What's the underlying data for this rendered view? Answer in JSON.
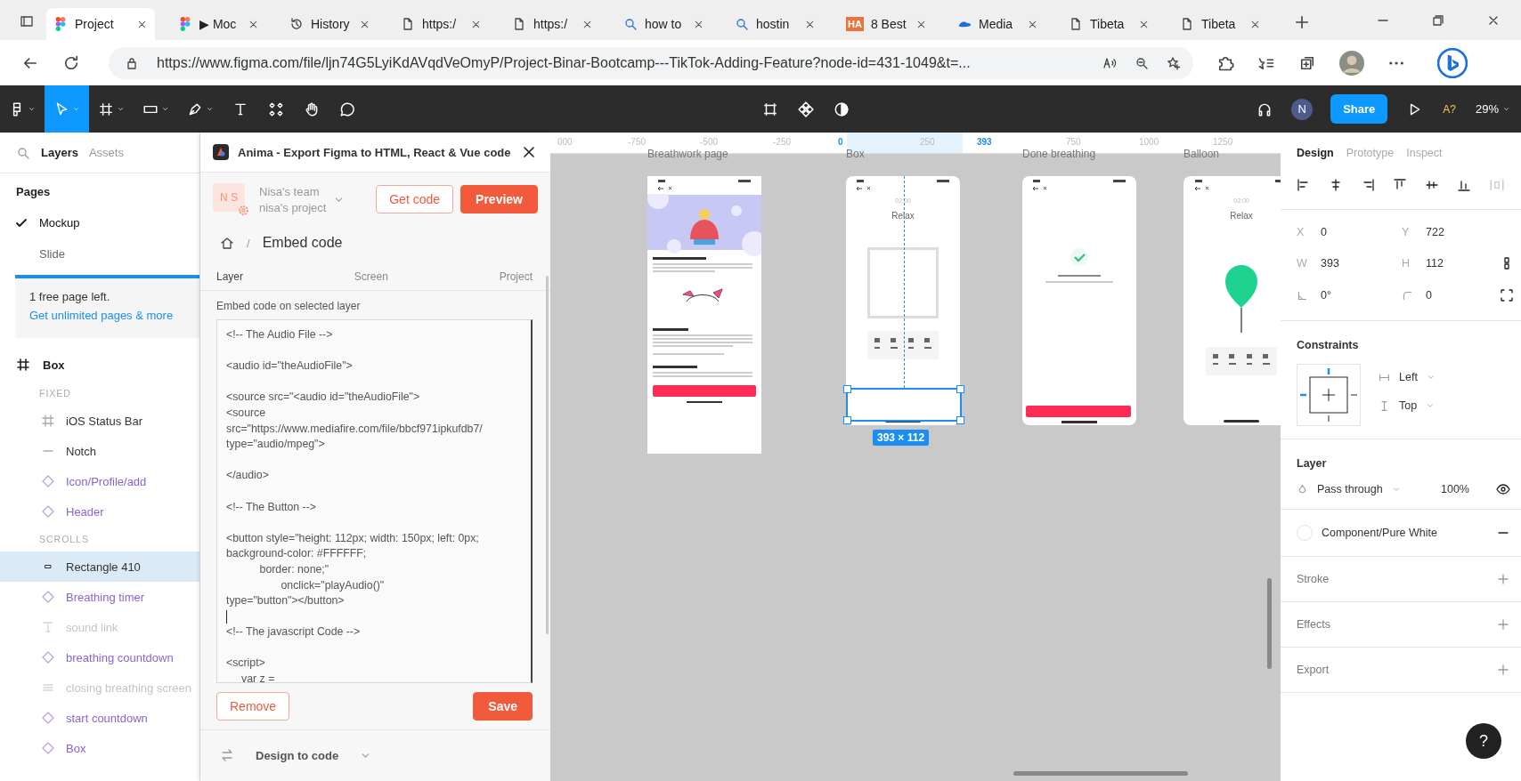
{
  "browser": {
    "tabs": [
      {
        "title": "Project",
        "selected": true
      },
      {
        "title": "▶ Moc",
        "selected": false
      },
      {
        "title": "History",
        "selected": false
      },
      {
        "title": "https:/",
        "selected": false
      },
      {
        "title": "https:/",
        "selected": false
      },
      {
        "title": "how to",
        "selected": false
      },
      {
        "title": "hostin",
        "selected": false
      },
      {
        "badge": "HA",
        "title": "8 Best",
        "selected": false
      },
      {
        "title": "Media",
        "selected": false
      },
      {
        "title": "Tibeta",
        "selected": false
      },
      {
        "title": "Tibeta",
        "selected": false
      }
    ],
    "url": "https://www.figma.com/file/ljn74G5LyiKdAVqdVeOmyP/Project-Binar-Bootcamp---TikTok-Adding-Feature?node-id=431-1049&t=..."
  },
  "toolbar": {
    "user_initial": "N",
    "share": "Share",
    "font_warning": "A?",
    "zoom": "29%"
  },
  "layers_panel": {
    "tabs": [
      {
        "label": "Layers",
        "selected": true
      },
      {
        "label": "Assets",
        "selected": false
      }
    ],
    "pages_title": "Pages",
    "pages": [
      {
        "label": "Mockup",
        "selected": true
      },
      {
        "label": "Slide",
        "selected": false
      }
    ],
    "promo": {
      "text": "1 free page left.",
      "link": "Get unlimited pages & more"
    },
    "frame": "Box",
    "groups": [
      {
        "title": "FIXED",
        "layers": [
          {
            "kind": "frame",
            "label": "iOS Status Bar",
            "selected": false,
            "hidden": false
          },
          {
            "kind": "line",
            "label": "Notch",
            "selected": false,
            "hidden": false
          },
          {
            "kind": "instance",
            "label": "Icon/Profile/add",
            "selected": false,
            "hidden": false
          },
          {
            "kind": "instance",
            "label": "Header",
            "selected": false,
            "hidden": false
          }
        ]
      },
      {
        "title": "SCROLLS",
        "layers": [
          {
            "kind": "rect",
            "label": "Rectangle 410",
            "selected": true,
            "hidden": false
          },
          {
            "kind": "instance",
            "label": "Breathing timer",
            "selected": false,
            "hidden": false
          },
          {
            "kind": "text",
            "label": "sound link",
            "selected": false,
            "hidden": true
          },
          {
            "kind": "instance",
            "label": "breathing countdown",
            "selected": false,
            "hidden": false
          },
          {
            "kind": "stack",
            "label": "closing breathing screen",
            "selected": false,
            "hidden": true
          },
          {
            "kind": "instance",
            "label": "start countdown",
            "selected": false,
            "hidden": false
          },
          {
            "kind": "instance",
            "label": "Box",
            "selected": false,
            "hidden": false
          }
        ]
      }
    ]
  },
  "anima": {
    "title": "Anima - Export Figma to HTML, React & Vue code",
    "avatar": "N S",
    "team": "Nisa's team",
    "project": "nisa's project",
    "get_code": "Get code",
    "preview": "Preview",
    "separator": "/",
    "breadcrumb": "Embed code",
    "tabs": [
      {
        "label": "Layer",
        "selected": true
      },
      {
        "label": "Screen",
        "selected": false
      },
      {
        "label": "Project",
        "selected": false
      }
    ],
    "field_label": "Embed code on selected layer",
    "code_lines": [
      {
        "kind": "text",
        "text": "<!-- The Audio File -->"
      },
      {
        "kind": "blank"
      },
      {
        "kind": "text",
        "text": "<audio id=\"theAudioFile\">"
      },
      {
        "kind": "blank"
      },
      {
        "kind": "text",
        "text": "<source src=\"<audio id=\"theAudioFile\">"
      },
      {
        "kind": "text",
        "text": "<source"
      },
      {
        "kind": "text",
        "text": "src=\"https://www.mediafire.com/file/bbcf971ipkufdb7/"
      },
      {
        "kind": "text",
        "text": "type=\"audio/mpeg\">"
      },
      {
        "kind": "blank"
      },
      {
        "kind": "text",
        "text": "</audio>"
      },
      {
        "kind": "blank"
      },
      {
        "kind": "text",
        "text": "<!-- The Button -->"
      },
      {
        "kind": "blank"
      },
      {
        "kind": "text",
        "text": "<button style=\"height: 112px; width: 150px; left: 0px;"
      },
      {
        "kind": "text",
        "text": "background-color: #FFFFFF;"
      },
      {
        "kind": "text",
        "text": "           border: none;\""
      },
      {
        "kind": "text",
        "text": "                  onclick=\"playAudio()\""
      },
      {
        "kind": "text",
        "text": "type=\"button\"></button>"
      },
      {
        "kind": "caret"
      },
      {
        "kind": "text",
        "text": "<!-- The javascript Code -->"
      },
      {
        "kind": "blank"
      },
      {
        "kind": "text",
        "text": "<script>"
      },
      {
        "kind": "text",
        "text": "     var z ="
      }
    ],
    "remove": "Remove",
    "save": "Save",
    "mode": "Design to code"
  },
  "canvas": {
    "ruler": [
      {
        "label": "000",
        "highlighted": false
      },
      {
        "label": "-750",
        "highlighted": false
      },
      {
        "label": "-500",
        "highlighted": false
      },
      {
        "label": "-250",
        "highlighted": false
      },
      {
        "label": "0",
        "highlighted": true
      },
      {
        "label": "250",
        "highlighted": false
      },
      {
        "label": "393",
        "highlighted": true
      },
      {
        "label": "750",
        "highlighted": false
      },
      {
        "label": "1000",
        "highlighted": false
      },
      {
        "label": "1250",
        "highlighted": false
      }
    ],
    "frames": [
      {
        "kind": "breathwork",
        "label": "Breathwork page"
      },
      {
        "kind": "box",
        "label": "Box",
        "timer": "02:00",
        "heading": "Relax"
      },
      {
        "kind": "done",
        "label": "Done breathing"
      },
      {
        "kind": "balloon",
        "label": "Balloon",
        "timer": "02:00",
        "heading": "Relax"
      }
    ],
    "selection_size": "393 × 112"
  },
  "design_panel": {
    "tabs": [
      {
        "label": "Design",
        "selected": true
      },
      {
        "label": "Prototype",
        "selected": false
      },
      {
        "label": "Inspect",
        "selected": false
      }
    ],
    "props": [
      {
        "kind": "letter",
        "label": "X",
        "value": "0"
      },
      {
        "kind": "letter",
        "label": "Y",
        "value": "722"
      },
      {
        "kind": "letter",
        "label": "W",
        "value": "393"
      },
      {
        "kind": "letter",
        "label": "H",
        "value": "112"
      },
      {
        "kind": "angle",
        "value": "0°"
      },
      {
        "kind": "radius",
        "value": "0"
      }
    ],
    "constraints": {
      "title": "Constraints",
      "horizontal": "Left",
      "vertical": "Top"
    },
    "layer": {
      "title": "Layer",
      "blend": "Pass through",
      "opacity": "100%"
    },
    "fill": "Component/Pure White",
    "sections": [
      "Stroke",
      "Effects",
      "Export"
    ],
    "help": "?"
  }
}
